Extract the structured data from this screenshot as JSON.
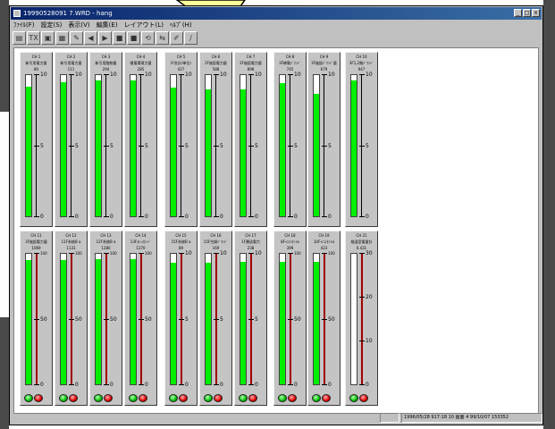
{
  "window": {
    "title": "19990528091 7.WRD - hang",
    "controls": [
      "_",
      "□",
      "×"
    ]
  },
  "menu": [
    "ﾌｧｲﾙ(F)",
    "設定(S)",
    "表示(V)",
    "編集(E)",
    "レイアウト(L)",
    "ﾍﾙﾌﾟ(H)"
  ],
  "toolbar": {
    "icons": [
      "open-icon",
      "text-icon",
      "print-icon",
      "chart-icon",
      "pen-icon",
      "left-arrow-icon",
      "right-arrow-icon",
      "pause-icon",
      "stop-icon",
      "loop-icon",
      "swap-icon",
      "edit-icon",
      "plot-icon"
    ],
    "glyphs": [
      "▤",
      "TX",
      "▣",
      "▦",
      "✎",
      "◀",
      "▶",
      "■",
      "■",
      "⟲",
      "⇆",
      "✐",
      "∕"
    ]
  },
  "row1": [
    {
      "ch": "CH 1",
      "name": "新引用電力量",
      "value": "80",
      "fill": 0.92
    },
    {
      "ch": "CH 2",
      "name": "新引用電力量",
      "value": "111",
      "fill": 0.95
    },
    {
      "ch": "CH 3",
      "name": "新引用融物量",
      "value": "294",
      "fill": 0.96
    },
    {
      "ch": "CH 4",
      "name": "植電環境力量",
      "value": "285",
      "fill": 0.96
    },
    {
      "ch": "CH 5",
      "name": "IF合計(単位)",
      "value": "427",
      "fill": 0.91
    },
    {
      "ch": "CH 6",
      "name": "2F施設電力量",
      "value": "588",
      "fill": 0.9
    },
    {
      "ch": "CH 7",
      "name": "2F施設電力量",
      "value": "898",
      "fill": 0.9
    },
    {
      "ch": "CH 8",
      "name": "3F稼電ﾃﾞﾏﾝﾄﾞ",
      "value": "745",
      "fill": 0.94
    },
    {
      "ch": "CH 9",
      "name": "3F施設ﾃﾞﾏﾝﾄﾞ量",
      "value": "679",
      "fill": 0.87
    },
    {
      "ch": "CH 10",
      "name": "3F1,2階ﾃﾞﾏﾝﾄﾞ",
      "value": "947",
      "fill": 0.96
    }
  ],
  "row1_scale": {
    "top": "10",
    "mid": "5",
    "bottom": "0"
  },
  "row2": [
    {
      "ch": "CH 11",
      "name": "3F施設電力量",
      "value": "1069",
      "fill": 0.95,
      "scale": [
        "100",
        "50",
        "0"
      ]
    },
    {
      "ch": "CH 12",
      "name": "11F系統B a",
      "value": "1131",
      "fill": 0.95,
      "scale": [
        "100",
        "50",
        "0"
      ]
    },
    {
      "ch": "CH 13",
      "name": "12F系統B a",
      "value": "1280",
      "fill": 0.96,
      "scale": [
        "100",
        "50",
        "0"
      ]
    },
    {
      "ch": "CH 14",
      "name": "13Fｽﾄｯｸｶｰﾄﾞ",
      "value": "1370",
      "fill": 0.96,
      "scale": [
        "100",
        "50",
        "0"
      ]
    },
    {
      "ch": "CH 15",
      "name": "15F系統B a",
      "value": "89",
      "fill": 0.93,
      "scale": [
        "10",
        "5",
        "0"
      ]
    },
    {
      "ch": "CH 16",
      "name": "15F空調ﾃﾞﾏﾝﾄﾞ",
      "value": "169",
      "fill": 0.93,
      "scale": [
        "10",
        "5",
        "0"
      ]
    },
    {
      "ch": "CH 17",
      "name": "1F運送電力",
      "value": "238",
      "fill": 0.94,
      "scale": [
        "10",
        "5",
        "0"
      ]
    },
    {
      "ch": "CH 18",
      "name": "8F<ｺﾝｾﾝﾄa",
      "value": "399",
      "fill": 0.94,
      "scale": [
        "100",
        "50",
        "0"
      ]
    },
    {
      "ch": "CH 19",
      "name": "10F<ｺﾝｾﾝﾄa",
      "value": "423",
      "fill": 0.94,
      "scale": [
        "100",
        "50",
        "0"
      ]
    },
    {
      "ch": "CH 21",
      "name": "検温室電量計",
      "value": "0.431",
      "fill": 0.0,
      "white": true,
      "scale": [
        "30",
        "20",
        "10",
        "0"
      ]
    }
  ],
  "status": {
    "left": "",
    "right": "1996/05/28 917:18  10 画面 4  99/10/07 153352"
  },
  "colors": {
    "bar_fill": "#00ee00",
    "led_ok": "#00c000",
    "led_alarm": "#e00000",
    "titlebar": "#08246b"
  }
}
